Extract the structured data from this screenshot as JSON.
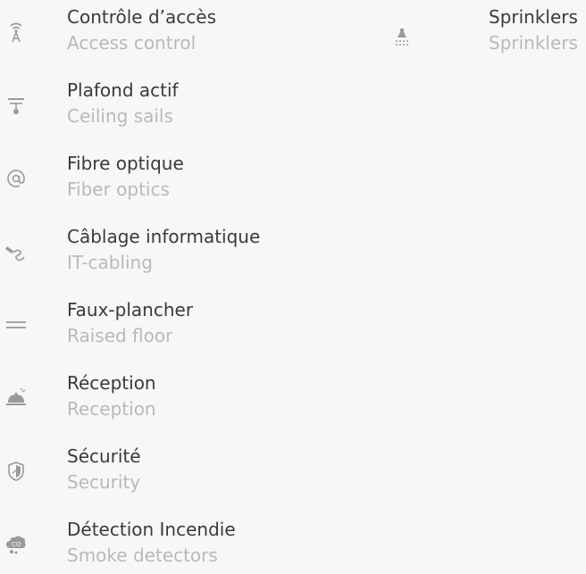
{
  "left_list": [
    {
      "title": "Contrôle d’accès",
      "subtitle": "Access control",
      "icon": "antenna-icon"
    },
    {
      "title": "Plafond actif",
      "subtitle": "Ceiling sails",
      "icon": "ceiling-lamp-icon"
    },
    {
      "title": "Fibre optique",
      "subtitle": "Fiber optics",
      "icon": "at-sign-icon"
    },
    {
      "title": "Câblage informatique",
      "subtitle": "IT-cabling",
      "icon": "cable-plug-icon"
    },
    {
      "title": "Faux-plancher",
      "subtitle": "Raised floor",
      "icon": "double-line-icon"
    },
    {
      "title": "Réception",
      "subtitle": "Reception",
      "icon": "service-bell-icon"
    },
    {
      "title": "Sécurité",
      "subtitle": "Security",
      "icon": "shield-icon"
    },
    {
      "title": "Détection Incendie",
      "subtitle": "Smoke detectors",
      "icon": "smoke-co-icon"
    }
  ],
  "right_list": [
    {
      "title": "Sprinklers",
      "subtitle": "Sprinklers",
      "icon": "sprinkler-icon"
    }
  ],
  "colors": {
    "title": "#3a3a3a",
    "subtitle": "#b9b9b9",
    "icon": "#9a9a9a",
    "background": "#f7f7f7"
  }
}
